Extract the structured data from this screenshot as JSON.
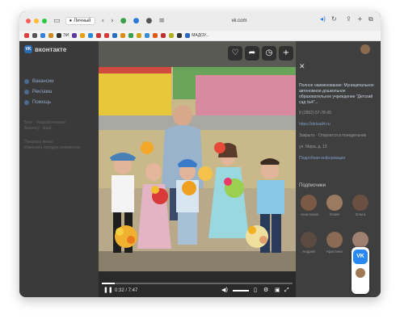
{
  "browser": {
    "profile_label": "Личный",
    "url": "vk.com",
    "bookmarks": [
      {
        "color": "#e04040",
        "label": ""
      },
      {
        "color": "#555555",
        "label": ""
      },
      {
        "color": "#3b7dd8",
        "label": ""
      },
      {
        "color": "#d08a20",
        "label": ""
      },
      {
        "color": "#333333",
        "label": "ЭИ"
      },
      {
        "color": "#5a3aa0",
        "label": ""
      },
      {
        "color": "#e8a010",
        "label": ""
      },
      {
        "color": "#2a8ad8",
        "label": ""
      },
      {
        "color": "#cc3333",
        "label": ""
      },
      {
        "color": "#d83a3a",
        "label": ""
      },
      {
        "color": "#2a6ac0",
        "label": ""
      },
      {
        "color": "#e08a10",
        "label": ""
      },
      {
        "color": "#3aa04a",
        "label": ""
      },
      {
        "color": "#d0a010",
        "label": ""
      },
      {
        "color": "#3a8ad8",
        "label": ""
      },
      {
        "color": "#e05a10",
        "label": ""
      },
      {
        "color": "#c03030",
        "label": ""
      },
      {
        "color": "#b0b020",
        "label": ""
      },
      {
        "color": "#333333",
        "label": ""
      },
      {
        "color": "#2a6ac0",
        "label": "МАДОУ..."
      }
    ]
  },
  "sidebar": {
    "brand": "вконтакте",
    "items": [
      {
        "label": "Вакансии"
      },
      {
        "label": "Реклама"
      },
      {
        "label": "Помощь"
      }
    ],
    "muted": [
      "Блог · Разработчикам",
      "Бизнесу · Ещё"
    ],
    "muted2": [
      "Показать меню",
      "Изменить порядок элементов"
    ]
  },
  "viewer": {
    "actions": [
      {
        "icon": "heart-icon",
        "glyph": "♡"
      },
      {
        "icon": "share-icon",
        "glyph": "➦"
      },
      {
        "icon": "clock-icon",
        "glyph": "◷"
      },
      {
        "icon": "plus-icon",
        "glyph": "+"
      }
    ],
    "time": "0:32 / 7:47",
    "progress": 0.068
  },
  "right_panel": {
    "title": "Полное наименование: Муниципальное автономное дошкольное образовательное учреждение \"Детский сад №4\"...",
    "phone": "8 (3952) 57-78-95",
    "site": "https://detsad4.ru",
    "hours": "Закрыто · Откроется в понедельник",
    "address": "ул. Мира, д. 10",
    "more": "Подробная информация",
    "friends_label": "Подписчики",
    "friends": [
      {
        "name": "Анастасия",
        "color": "#7a5a45"
      },
      {
        "name": "Юлия",
        "color": "#9a7a60"
      },
      {
        "name": "Ольга",
        "color": "#6a5040"
      },
      {
        "name": "Андрей",
        "color": "#5a4a40"
      },
      {
        "name": "Кристина",
        "color": "#8a6a55"
      },
      {
        "name": "Ирина",
        "color": "#a08070"
      }
    ]
  }
}
